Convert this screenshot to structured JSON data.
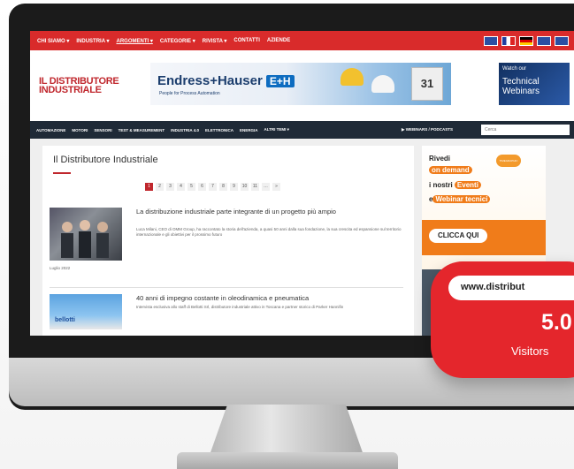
{
  "top_nav": {
    "items": [
      "CHI SIAMO ▾",
      "INDUSTRIA ▾",
      "ARGOMENTI ▾",
      "CATEGORIE ▾",
      "RIVISTA ▾",
      "CONTATTI",
      "AZIENDE"
    ],
    "flag_colors": [
      "#2b4fa3",
      "#ffffff",
      "#2b4fa3",
      "#000000",
      "#2b4fa3"
    ]
  },
  "header": {
    "logo_line1": "IL DISTRIBUTORE",
    "logo_line2": "INDUSTRIALE",
    "banner_brand": "Endress+Hauser",
    "banner_badge": "E+H",
    "banner_tagline": "People for Process Automation",
    "banner_number": "31",
    "webinar_small": "Watch our",
    "webinar_big": "Technical Webinars"
  },
  "cat_nav": {
    "items": [
      "AUTOMAZIONE",
      "MOTORI",
      "SENSORI",
      "TEST & MEASUREMENT",
      "INDUSTRIA 4.0",
      "ELETTRONICA",
      "ENERGIA",
      "ALTRI TEMI ▾"
    ],
    "webinars_label": "▶ WEBINARS / PODCASTS",
    "search_placeholder": "Cerca"
  },
  "content": {
    "page_title": "Il Distributore Industriale",
    "pagination": [
      "1",
      "2",
      "3",
      "4",
      "5",
      "6",
      "7",
      "8",
      "9",
      "10",
      "11",
      "…",
      "»"
    ],
    "articles": [
      {
        "title": "La distribuzione industriale parte integrante di un progetto più ampio",
        "excerpt": "Luca Milani, CEO di OMM Group, ha raccontato la storia dell'azienda, a quasi 50 anni dalla sua fondazione, la sua crescita ed espansione sul territorio internazionale e gli obiettivi per il prossimo futuro",
        "date": "Luglio 2022"
      },
      {
        "title": "40 anni di impegno costante in oleodinamica e pneumatica",
        "excerpt": "Intervista esclusiva allo staff di Bellotti Srl, distributore industriale attivo in Toscana e partner storico di Parker Hannifin",
        "thumb_label": "bellotti"
      }
    ]
  },
  "sidebar": {
    "promo_line1": "Rivedi",
    "promo_pill1": "on demand",
    "promo_line3": "i nostri",
    "promo_pill2": "Eventi",
    "promo_line4_prefix": "e",
    "promo_pill3": "Webinar tecnici",
    "promo_logo": "TIMEGRAPHIC",
    "promo_cta": "CLICCA QUI"
  },
  "badge": {
    "url": "www.distribut",
    "big_number": "5.0",
    "label": "Visitors"
  },
  "colors": {
    "brand_red": "#d92b2b",
    "dark_nav": "#1f2a37",
    "promo_orange": "#f07c1a",
    "badge_red": "#e4262c"
  }
}
